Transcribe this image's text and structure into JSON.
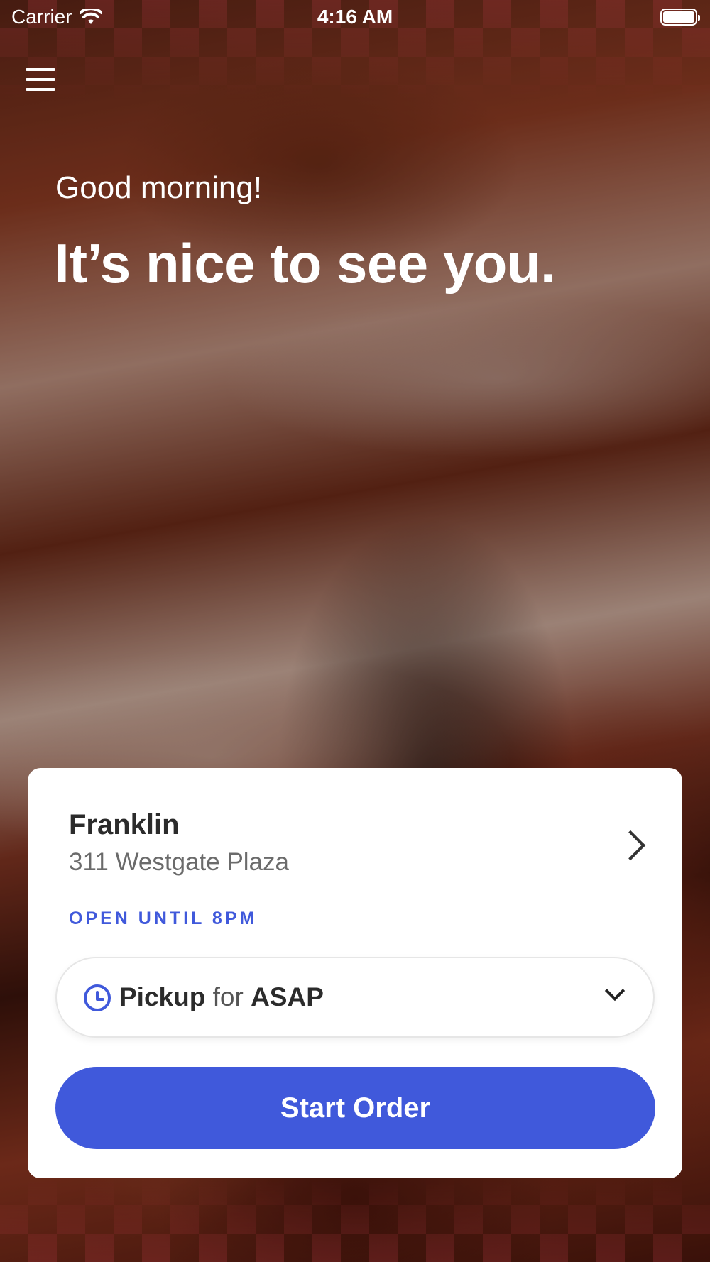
{
  "status_bar": {
    "carrier": "Carrier",
    "time": "4:16 AM",
    "wifi_icon": "wifi-icon",
    "battery_icon": "battery-icon"
  },
  "header": {
    "menu_icon": "hamburger-menu-icon",
    "greeting": "Good morning!",
    "headline": "It’s nice to see you."
  },
  "location": {
    "name": "Franklin",
    "address": "311 Westgate Plaza",
    "hours": "OPEN UNTIL 8PM",
    "chevron_icon": "chevron-right-icon"
  },
  "order_mode": {
    "mode": "Pickup",
    "connector": "for",
    "time": "ASAP",
    "clock_icon": "clock-icon",
    "dropdown_icon": "chevron-down-icon"
  },
  "actions": {
    "start_order": "Start Order"
  },
  "colors": {
    "accent": "#4059db",
    "card_bg": "#ffffff"
  }
}
